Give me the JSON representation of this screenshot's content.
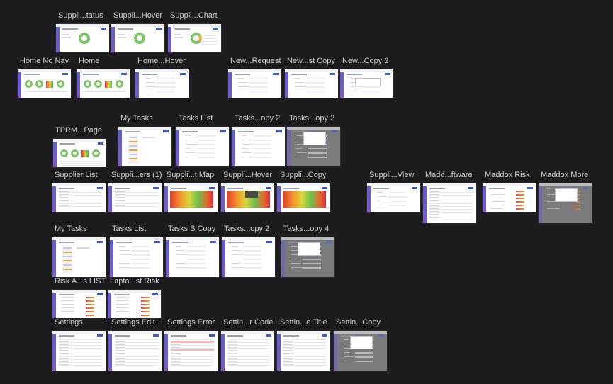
{
  "artboards": [
    {
      "label": "Suppli...tatus",
      "kind": "donut"
    },
    {
      "label": "Suppli...Hover",
      "kind": "donut"
    },
    {
      "label": "Suppli...Chart",
      "kind": "donut_orange"
    },
    {
      "label": "Home No Nav",
      "kind": "home"
    },
    {
      "label": "Home",
      "kind": "home"
    },
    {
      "label": "Home...Hover",
      "kind": "form"
    },
    {
      "label": "New...Request",
      "kind": "form"
    },
    {
      "label": "New...st Copy",
      "kind": "form"
    },
    {
      "label": "New...Copy 2",
      "kind": "form_modal"
    },
    {
      "label": "TPRM...Page",
      "kind": "home"
    },
    {
      "label": "My Tasks",
      "kind": "tasks"
    },
    {
      "label": "Tasks List",
      "kind": "form"
    },
    {
      "label": "Tasks...opy 2",
      "kind": "form"
    },
    {
      "label": "Tasks...opy 2",
      "kind": "modal_dim"
    },
    {
      "label": "Supplier List",
      "kind": "table"
    },
    {
      "label": "Suppli...ers (1)",
      "kind": "table"
    },
    {
      "label": "Suppli...t Map",
      "kind": "heat"
    },
    {
      "label": "Suppli...Hover",
      "kind": "heat_hover"
    },
    {
      "label": "Suppli...Copy",
      "kind": "heat"
    },
    {
      "label": "Suppli...View",
      "kind": "form"
    },
    {
      "label": "Madd...ftware",
      "kind": "table"
    },
    {
      "label": "Maddox Risk",
      "kind": "risk"
    },
    {
      "label": "Maddox More",
      "kind": "risk_dim"
    },
    {
      "label": "My Tasks",
      "kind": "tasks"
    },
    {
      "label": "Tasks List",
      "kind": "form"
    },
    {
      "label": "Tasks B Copy",
      "kind": "form"
    },
    {
      "label": "Tasks...opy 2",
      "kind": "form"
    },
    {
      "label": "Tasks...opy 4",
      "kind": "modal_dim"
    },
    {
      "label": "Risk A...s LIST",
      "kind": "risk"
    },
    {
      "label": "Lapto...st Risk",
      "kind": "risk"
    },
    {
      "label": "Settings",
      "kind": "table"
    },
    {
      "label": "Settings Edit",
      "kind": "table"
    },
    {
      "label": "Settings Error",
      "kind": "settings_error"
    },
    {
      "label": "Settin...r Code",
      "kind": "table"
    },
    {
      "label": "Settin...e Title",
      "kind": "table"
    },
    {
      "label": "Settin...Copy",
      "kind": "modal_dim"
    }
  ]
}
